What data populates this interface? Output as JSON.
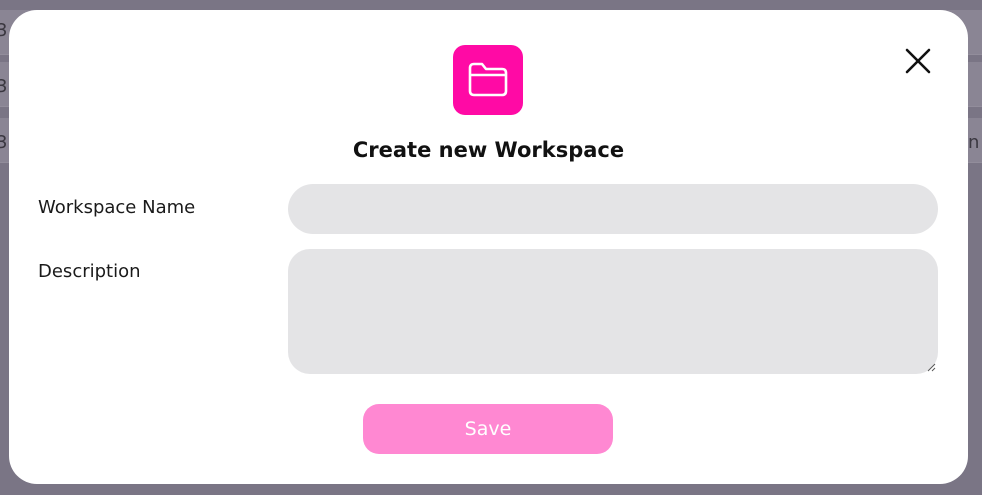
{
  "background": {
    "row_fragments": [
      "3",
      "3",
      "3",
      "n"
    ]
  },
  "modal": {
    "title": "Create new Workspace",
    "icon": "folder-icon",
    "close_icon": "close-icon",
    "accent_color": "#ff0aa5",
    "fields": {
      "name": {
        "label": "Workspace Name",
        "value": "",
        "placeholder": ""
      },
      "description": {
        "label": "Description",
        "value": "",
        "placeholder": ""
      }
    },
    "save_label": "Save",
    "save_color": "#ff88d2"
  }
}
